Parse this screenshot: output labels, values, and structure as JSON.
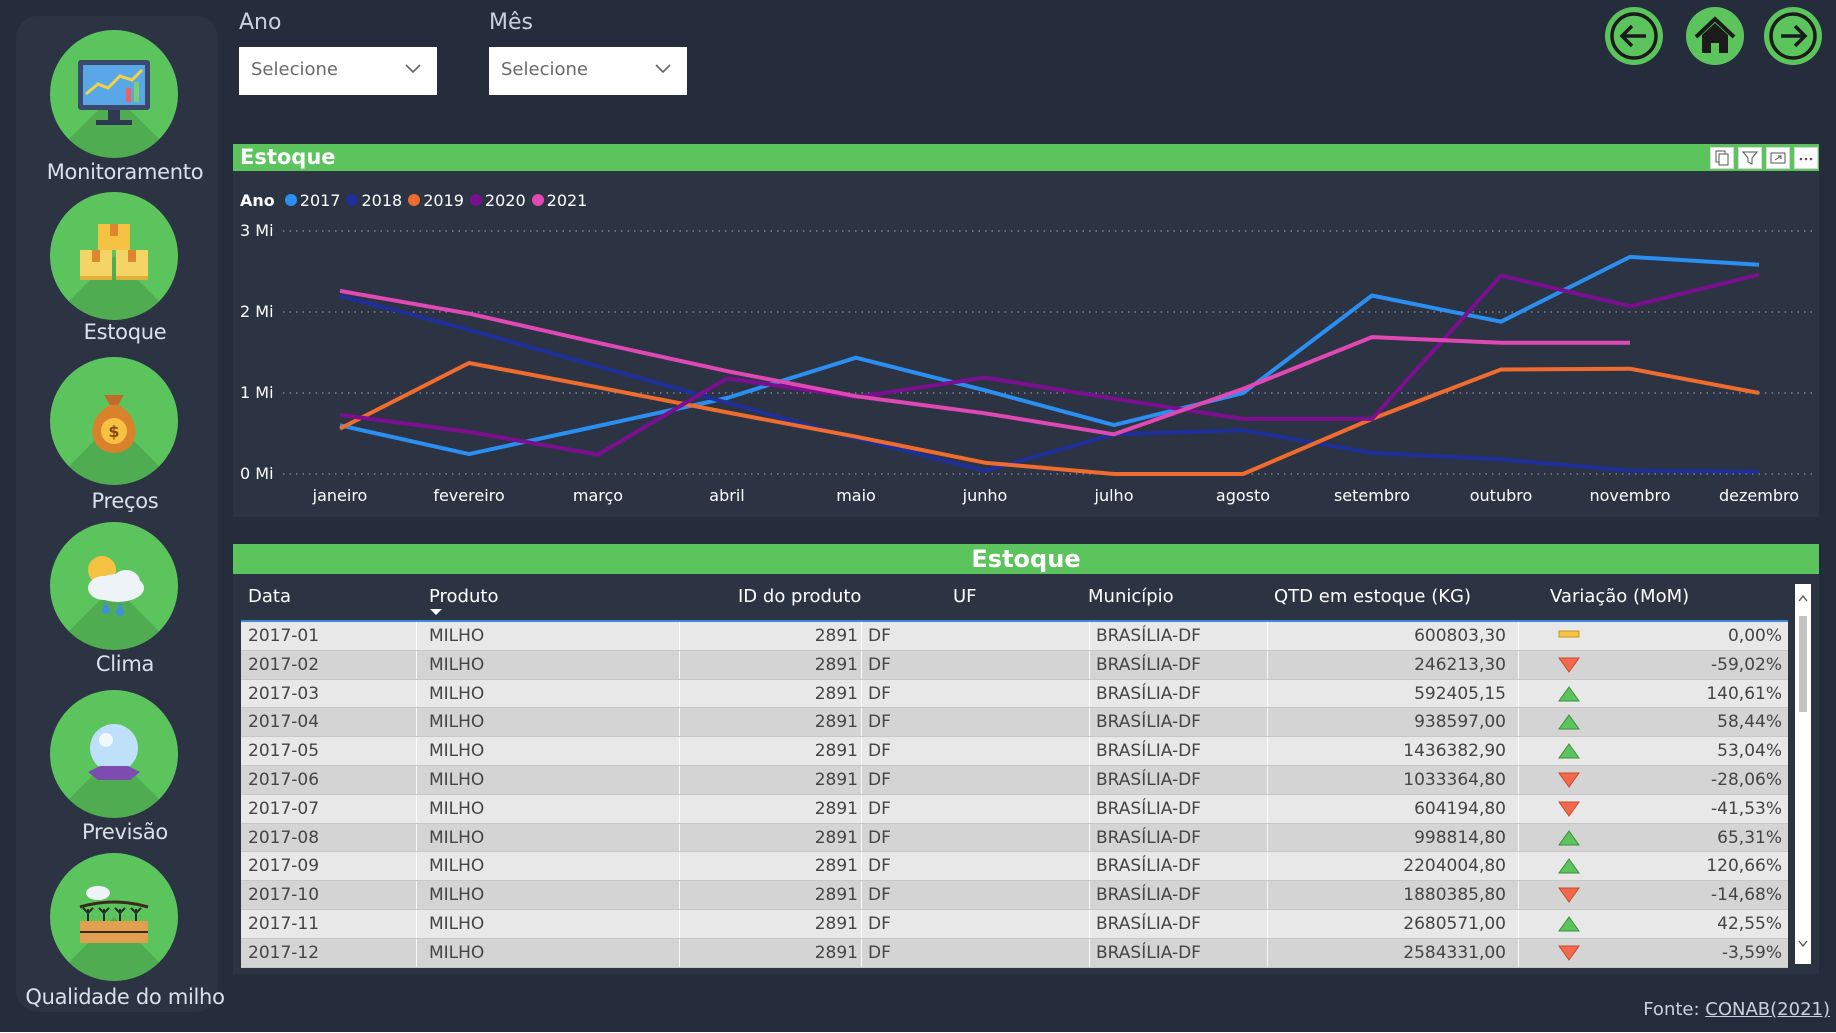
{
  "sidebar": {
    "items": [
      {
        "label": "Monitoramento",
        "icon": "monitor-chart-icon"
      },
      {
        "label": "Estoque",
        "icon": "boxes-icon"
      },
      {
        "label": "Preços",
        "icon": "money-bag-icon"
      },
      {
        "label": "Clima",
        "icon": "weather-icon"
      },
      {
        "label": "Previsão",
        "icon": "crystal-ball-icon"
      },
      {
        "label": "Qualidade do milho",
        "icon": "crop-field-icon"
      }
    ]
  },
  "filters": {
    "ano": {
      "label": "Ano",
      "value": "Selecione"
    },
    "mes": {
      "label": "Mês",
      "value": "Selecione"
    }
  },
  "chart_card": {
    "title": "Estoque"
  },
  "chart_data": {
    "type": "line",
    "legend_title": "Ano",
    "categories": [
      "janeiro",
      "fevereiro",
      "março",
      "abril",
      "maio",
      "junho",
      "julho",
      "agosto",
      "setembro",
      "outubro",
      "novembro",
      "dezembro"
    ],
    "y_ticks": [
      "0 Mi",
      "1 Mi",
      "2 Mi",
      "3 Mi"
    ],
    "ylim": [
      0,
      3000000
    ],
    "grid": true,
    "legend_position": "top-left",
    "series": [
      {
        "name": "2017",
        "color": "#2b8ff2",
        "values": [
          600803.3,
          246213.3,
          592405.15,
          938597.0,
          1436382.9,
          1033364.8,
          604194.8,
          998814.8,
          2204004.8,
          1880385.8,
          2680571.0,
          2584331.0
        ]
      },
      {
        "name": "2018",
        "color": "#1e2f9a",
        "values": [
          2200000,
          1780000,
          1330000,
          880000,
          440000,
          40000,
          490000,
          540000,
          260000,
          180000,
          40000,
          30000
        ]
      },
      {
        "name": "2019",
        "color": "#ef6c2e",
        "values": [
          560000,
          1370000,
          1070000,
          760000,
          460000,
          140000,
          0,
          0,
          680000,
          1290000,
          1300000,
          1000000
        ]
      },
      {
        "name": "2020",
        "color": "#7a0f8f",
        "values": [
          730000,
          520000,
          240000,
          1180000,
          950000,
          1190000,
          930000,
          680000,
          680000,
          2450000,
          2070000,
          2460000
        ]
      },
      {
        "name": "2021",
        "color": "#e049b3",
        "values": [
          2260000,
          1980000,
          1620000,
          1270000,
          960000,
          750000,
          490000,
          1050000,
          1690000,
          1620000,
          1620000,
          null
        ]
      }
    ]
  },
  "table": {
    "title": "Estoque",
    "columns": [
      "Data",
      "Produto",
      "ID do produto",
      "UF",
      "Município",
      "QTD em estoque (KG)",
      "Variação (MoM)"
    ],
    "rows": [
      {
        "data": "2017-01",
        "produto": "MILHO",
        "id": "2891",
        "uf": "DF",
        "municipio": "BRASÍLIA-DF",
        "qtd": "600803,30",
        "trend": "flat",
        "variacao": "0,00%"
      },
      {
        "data": "2017-02",
        "produto": "MILHO",
        "id": "2891",
        "uf": "DF",
        "municipio": "BRASÍLIA-DF",
        "qtd": "246213,30",
        "trend": "down",
        "variacao": "-59,02%"
      },
      {
        "data": "2017-03",
        "produto": "MILHO",
        "id": "2891",
        "uf": "DF",
        "municipio": "BRASÍLIA-DF",
        "qtd": "592405,15",
        "trend": "up",
        "variacao": "140,61%"
      },
      {
        "data": "2017-04",
        "produto": "MILHO",
        "id": "2891",
        "uf": "DF",
        "municipio": "BRASÍLIA-DF",
        "qtd": "938597,00",
        "trend": "up",
        "variacao": "58,44%"
      },
      {
        "data": "2017-05",
        "produto": "MILHO",
        "id": "2891",
        "uf": "DF",
        "municipio": "BRASÍLIA-DF",
        "qtd": "1436382,90",
        "trend": "up",
        "variacao": "53,04%"
      },
      {
        "data": "2017-06",
        "produto": "MILHO",
        "id": "2891",
        "uf": "DF",
        "municipio": "BRASÍLIA-DF",
        "qtd": "1033364,80",
        "trend": "down",
        "variacao": "-28,06%"
      },
      {
        "data": "2017-07",
        "produto": "MILHO",
        "id": "2891",
        "uf": "DF",
        "municipio": "BRASÍLIA-DF",
        "qtd": "604194,80",
        "trend": "down",
        "variacao": "-41,53%"
      },
      {
        "data": "2017-08",
        "produto": "MILHO",
        "id": "2891",
        "uf": "DF",
        "municipio": "BRASÍLIA-DF",
        "qtd": "998814,80",
        "trend": "up",
        "variacao": "65,31%"
      },
      {
        "data": "2017-09",
        "produto": "MILHO",
        "id": "2891",
        "uf": "DF",
        "municipio": "BRASÍLIA-DF",
        "qtd": "2204004,80",
        "trend": "up",
        "variacao": "120,66%"
      },
      {
        "data": "2017-10",
        "produto": "MILHO",
        "id": "2891",
        "uf": "DF",
        "municipio": "BRASÍLIA-DF",
        "qtd": "1880385,80",
        "trend": "down",
        "variacao": "-14,68%"
      },
      {
        "data": "2017-11",
        "produto": "MILHO",
        "id": "2891",
        "uf": "DF",
        "municipio": "BRASÍLIA-DF",
        "qtd": "2680571,00",
        "trend": "up",
        "variacao": "42,55%"
      },
      {
        "data": "2017-12",
        "produto": "MILHO",
        "id": "2891",
        "uf": "DF",
        "municipio": "BRASÍLIA-DF",
        "qtd": "2584331,00",
        "trend": "down",
        "variacao": "-3,59%"
      }
    ]
  },
  "footer": {
    "prefix": "Fonte: ",
    "link": "CONAB(2021)"
  },
  "colors": {
    "background": "#252d3c",
    "panel": "#2c3444",
    "accent_green": "#5cc45d",
    "trend_up": "#5cc45d",
    "trend_down": "#f26a4b",
    "trend_flat": "#f5c242"
  }
}
